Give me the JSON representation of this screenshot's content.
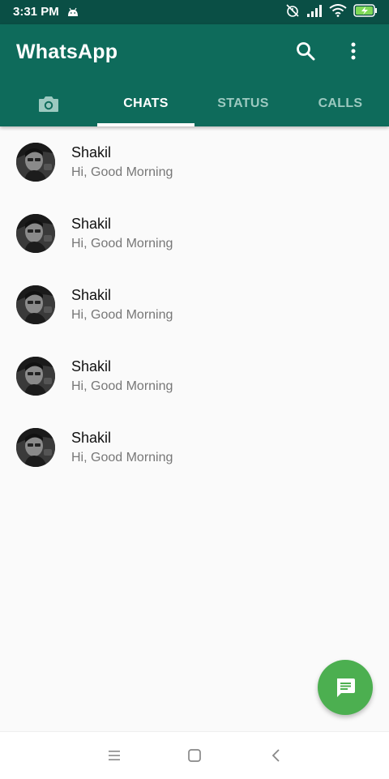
{
  "status_bar": {
    "time": "3:31 PM",
    "icons": [
      "android-icon",
      "alarm-off-icon",
      "signal-icon",
      "wifi-icon",
      "battery-charging-icon"
    ]
  },
  "app_bar": {
    "title": "WhatsApp",
    "actions": [
      "search-icon",
      "more-vert-icon"
    ]
  },
  "tabs": {
    "camera_icon": "camera-icon",
    "items": [
      {
        "label": "CHATS",
        "active": true
      },
      {
        "label": "STATUS",
        "active": false
      },
      {
        "label": "CALLS",
        "active": false
      }
    ]
  },
  "chats": [
    {
      "name": "Shakil",
      "message": "Hi, Good Morning"
    },
    {
      "name": "Shakil",
      "message": "Hi, Good Morning"
    },
    {
      "name": "Shakil",
      "message": "Hi, Good Morning"
    },
    {
      "name": "Shakil",
      "message": "Hi, Good Morning"
    },
    {
      "name": "Shakil",
      "message": "Hi, Good Morning"
    }
  ],
  "fab": {
    "icon": "message-icon"
  },
  "nav_bar": {
    "icons": [
      "menu-icon",
      "home-icon",
      "back-icon"
    ]
  },
  "colors": {
    "status_bar": "#0a4f45",
    "app_bar": "#0e6b5b",
    "fab": "#4caf50",
    "inactive_tab": "#9cc9c0"
  }
}
